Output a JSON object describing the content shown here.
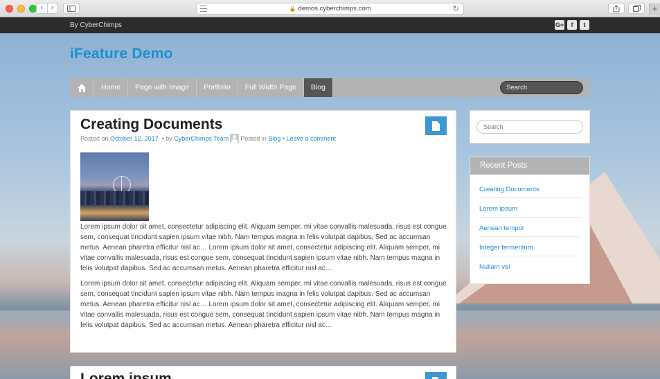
{
  "browser": {
    "url": "demos.cyberchimps.com"
  },
  "topbar": {
    "byline": "By CyberChimps",
    "social": [
      "google-plus-icon",
      "facebook-icon",
      "twitter-icon"
    ],
    "social_glyphs": [
      "G+",
      "f",
      "t"
    ]
  },
  "site": {
    "title": "iFeature Demo"
  },
  "menu": {
    "items": [
      "Home",
      "Page with Image",
      "Portfolio",
      "Full Width Page",
      "Blog"
    ],
    "active": "Blog",
    "search_placeholder": "Search"
  },
  "post": {
    "title": "Creating Documents",
    "posted_on": "Posted on",
    "date": "October 12, 2017",
    "by": "• by",
    "author": "CyberChimps Team",
    "posted_in": "Posted in",
    "category": "Blog",
    "separator": "•",
    "comment_link": "Leave a comment",
    "paragraphs": [
      "Lorem ipsum dolor sit amet, consectetur adipiscing elit. Aliquam semper, mi vitae convallis malesuada, risus est congue sem, consequat tincidunt sapien ipsum vitae nibh. Nam tempus magna in felis volutpat dapibus. Sed ac accumsan metus. Aenean pharetra efficitur nisl ac… Lorem ipsum dolor sit amet, consectetur adipiscing elit. Aliquam semper, mi vitae convallis malesuada, risus est congue sem, consequat tincidunt sapien ipsum vitae nibh. Nam tempus magna in felis volutpat dapibus. Sed ac accumsan metus. Aenean pharetra efficitur nisl ac…",
      "Lorem ipsum dolor sit amet, consectetur adipiscing elit. Aliquam semper, mi vitae convallis malesuada, risus est congue sem, consequat tincidunt sapien ipsum vitae nibh. Nam tempus magna in felis volutpat dapibus. Sed ac accumsan metus. Aenean pharetra efficitur nisl ac… Lorem ipsum dolor sit amet, consectetur adipiscing elit. Aliquam semper, mi vitae convallis malesuada, risus est congue sem, consequat tincidunt sapien ipsum vitae nibh. Nam tempus magna in felis volutpat dapibus. Sed ac accumsan metus. Aenean pharetra efficitur nisl ac…"
    ]
  },
  "post2": {
    "title": "Lorem ipsum"
  },
  "sidebar": {
    "search_placeholder": "Search",
    "recent_title": "Recent Posts",
    "recent_posts": [
      "Creating Documents",
      "Lorem ipsum",
      "Aenean tempor",
      "Integer fermentum",
      "Nullam vel"
    ]
  },
  "colors": {
    "accent": "#1a8fd3",
    "menu_bg": "#b3b3b3",
    "menu_active": "#555555",
    "topbar": "#2c2c2c"
  }
}
